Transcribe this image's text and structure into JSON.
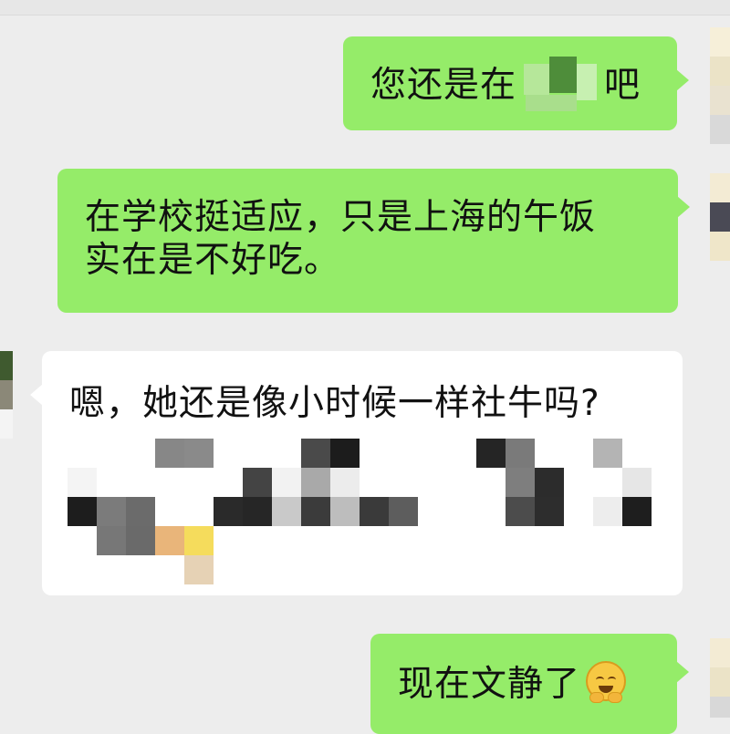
{
  "messages": [
    {
      "id": "m1",
      "direction": "outgoing",
      "text_before": "您还是在",
      "text_after": "吧",
      "redacted": true
    },
    {
      "id": "m2",
      "direction": "outgoing",
      "line1": "在学校挺适应，只是上海的午饭",
      "line2": "实在是不好吃。"
    },
    {
      "id": "m3",
      "direction": "incoming",
      "text": "嗯，她还是像小时候一样社牛吗?",
      "redacted_rest": true
    },
    {
      "id": "m4",
      "direction": "outgoing",
      "text": "现在文静了",
      "emoji": "embarrassed-smile-emoji"
    }
  ],
  "colors": {
    "background": "#ededed",
    "outgoing_bubble": "#95ec69",
    "incoming_bubble": "#ffffff",
    "text": "#111111"
  }
}
